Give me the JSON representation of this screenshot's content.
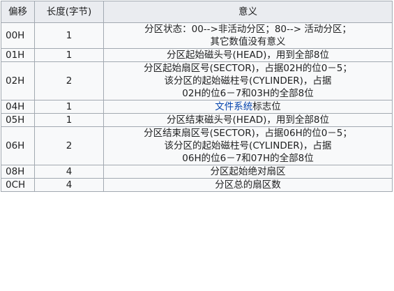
{
  "headers": [
    "偏移",
    "长度(字节)",
    "意义"
  ],
  "rows": [
    {
      "offset": "00H",
      "length": "1",
      "lines": [
        "分区状态：00-->非活动分区；80--> 活动分区；",
        "其它数值没有意义"
      ]
    },
    {
      "offset": "01H",
      "length": "1",
      "lines": [
        "分区起始磁头号(HEAD)，用到全部8位"
      ]
    },
    {
      "offset": "02H",
      "length": "2",
      "lines": [
        "分区起始扇区号(SECTOR)，占据02H的位0－5；",
        "该分区的起始磁柱号(CYLINDER)，占据",
        "02H的位6－7和03H的全部8位"
      ]
    },
    {
      "offset": "04H",
      "length": "1",
      "link": "文件系统",
      "rest": "标志位"
    },
    {
      "offset": "05H",
      "length": "1",
      "lines": [
        "分区结束磁头号(HEAD)，用到全部8位"
      ]
    },
    {
      "offset": "06H",
      "length": "2",
      "lines": [
        "分区结束扇区号(SECTOR)，占据06H的位0－5；",
        "该分区的起始磁柱号(CYLINDER)，占据",
        "06H的位6－7和07H的全部8位"
      ]
    },
    {
      "offset": "08H",
      "length": "4",
      "lines": [
        "分区起始绝对扇区"
      ]
    },
    {
      "offset": "0CH",
      "length": "4",
      "lines": [
        "分区总的扇区数"
      ]
    }
  ],
  "colors": {
    "header_bg": "#eaecf0",
    "cell_bg": "#f8f9fa",
    "border": "#a2a9b1",
    "link": "#0645ad"
  }
}
